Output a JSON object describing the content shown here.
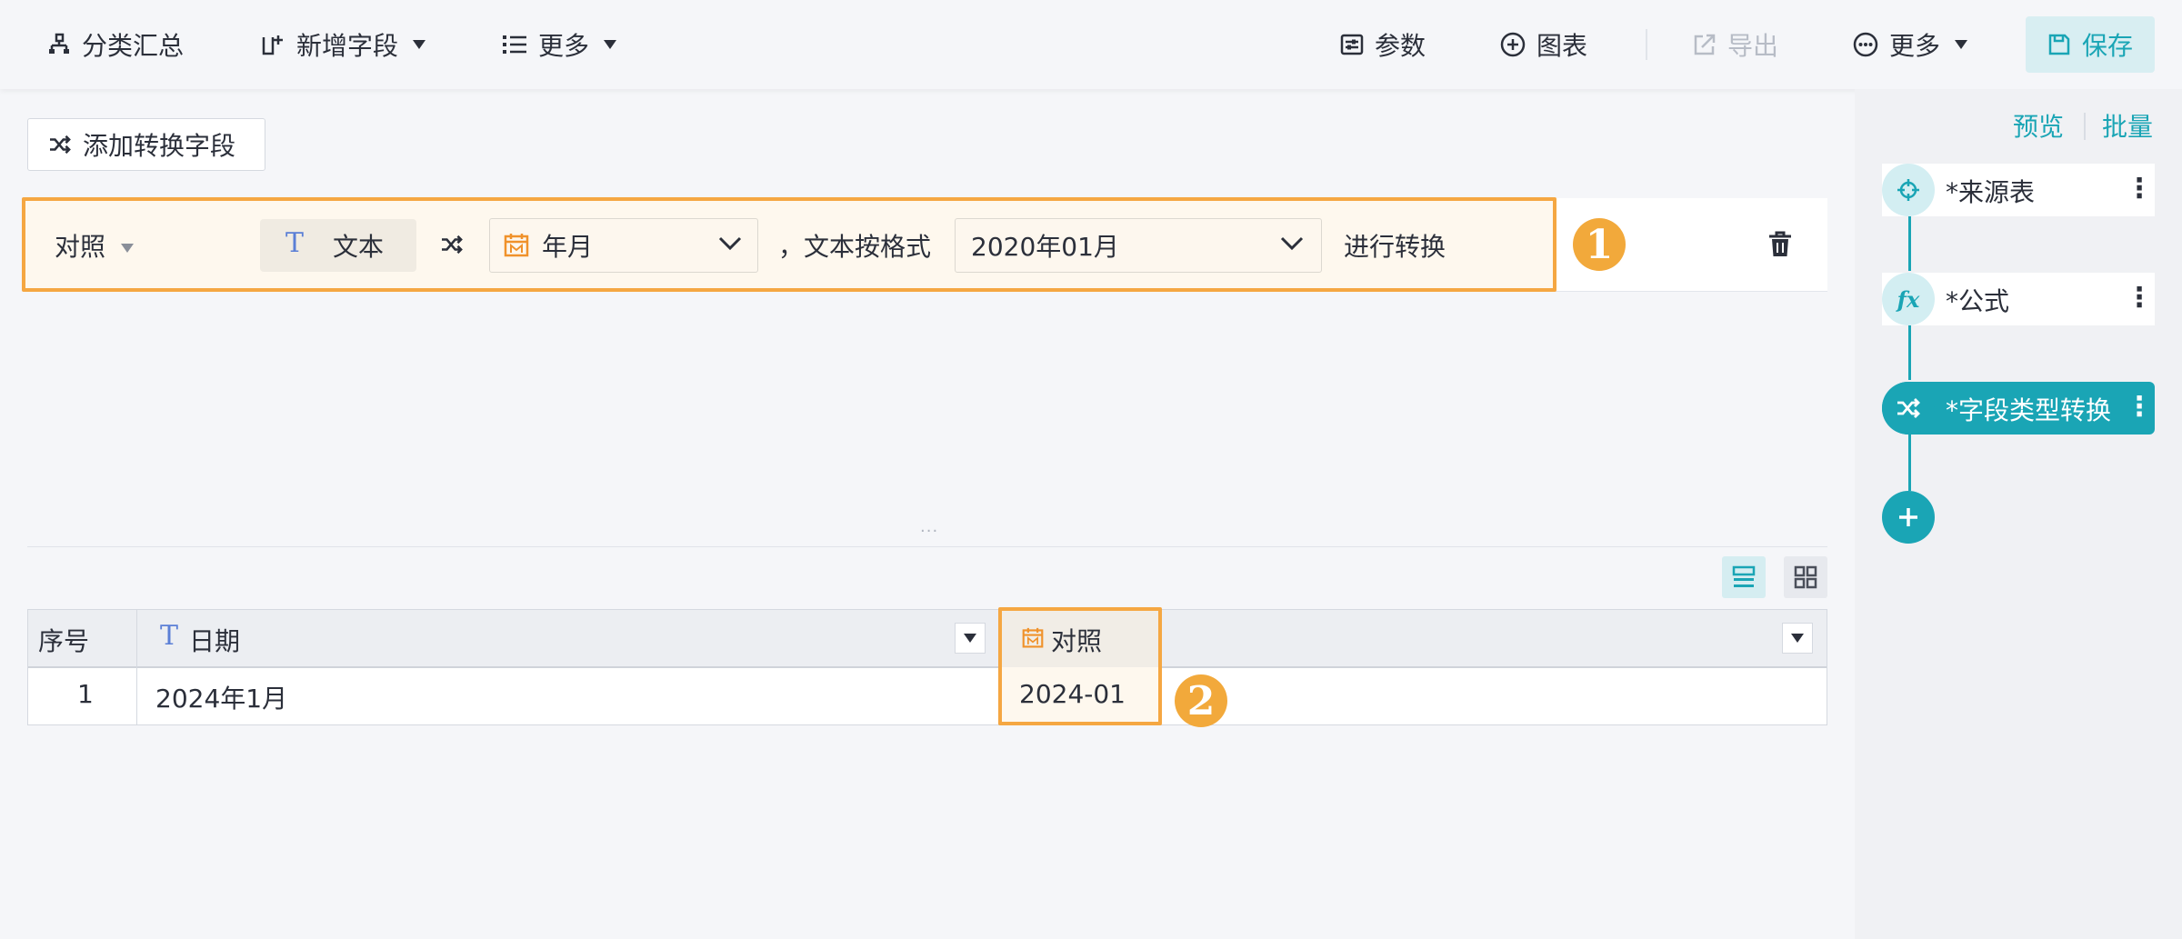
{
  "toolbar": {
    "group_summary": "分类汇总",
    "add_field": "新增字段",
    "more_left": "更多",
    "params": "参数",
    "chart": "图表",
    "export": "导出",
    "more_right": "更多",
    "save": "保存"
  },
  "right_panel": {
    "preview": "预览",
    "batch": "批量",
    "steps": [
      {
        "label": "*来源表",
        "icon": "target-icon"
      },
      {
        "label": "*公式",
        "icon": "fx-icon"
      },
      {
        "label": "*字段类型转换",
        "icon": "shuffle-icon",
        "active": true
      }
    ]
  },
  "main": {
    "add_transform": "添加转换字段",
    "rule": {
      "field": "对照",
      "source_type": "文本",
      "target_type": "年月",
      "by_format_text": "，文本按格式",
      "format": "2020年01月",
      "action": "进行转换",
      "badge": "1"
    },
    "splitter": "···",
    "table": {
      "columns": [
        "序号",
        "日期",
        "对照"
      ],
      "rows": [
        [
          "1",
          "2024年1月",
          "2024-01"
        ]
      ],
      "badge": "2"
    }
  },
  "colors": {
    "accent": "#1aa5b5",
    "highlight": "#f5a742",
    "badge": "#f2a93b",
    "field_icon_blue": "#5b7fd6",
    "date_icon_orange": "#f0922b"
  }
}
